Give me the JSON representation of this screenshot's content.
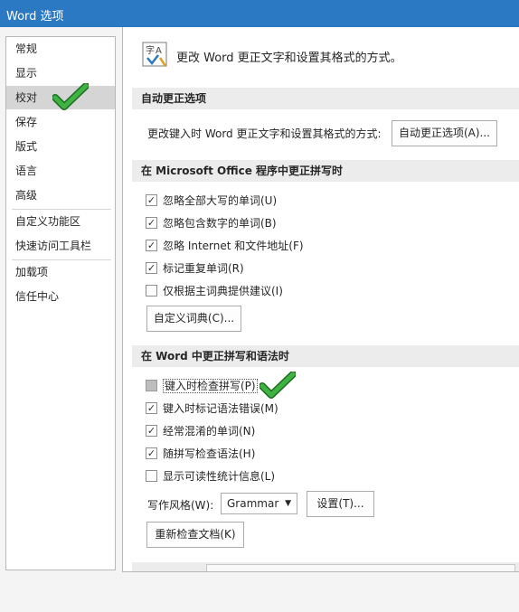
{
  "window": {
    "title": "Word 选项"
  },
  "sidebar": {
    "items": [
      {
        "label": "常规"
      },
      {
        "label": "显示"
      },
      {
        "label": "校对"
      },
      {
        "label": "保存"
      },
      {
        "label": "版式"
      },
      {
        "label": "语言"
      },
      {
        "label": "高级"
      },
      {
        "label": "自定义功能区"
      },
      {
        "label": "快速访问工具栏"
      },
      {
        "label": "加载项"
      },
      {
        "label": "信任中心"
      }
    ],
    "selected": "校对"
  },
  "header": {
    "text": "更改 Word 更正文字和设置其格式的方式。",
    "icon": "proofing-abc-check-icon"
  },
  "autocorrect": {
    "title": "自动更正选项",
    "description": "更改键入时 Word 更正文字和设置其格式的方式:",
    "button": "自动更正选项(A)..."
  },
  "office_spelling": {
    "title": "在 Microsoft Office 程序中更正拼写时",
    "options": [
      {
        "label": "忽略全部大写的单词(U)",
        "checked": true
      },
      {
        "label": "忽略包含数字的单词(B)",
        "checked": true
      },
      {
        "label": "忽略 Internet 和文件地址(F)",
        "checked": true
      },
      {
        "label": "标记重复单词(R)",
        "checked": true
      },
      {
        "label": "仅根据主词典提供建议(I)",
        "checked": false
      }
    ],
    "dictionary_button": "自定义词典(C)..."
  },
  "word_spelling": {
    "title": "在 Word 中更正拼写和语法时",
    "options": [
      {
        "label": "键入时检查拼写(P)",
        "checked": false
      },
      {
        "label": "键入时标记语法错误(M)",
        "checked": true
      },
      {
        "label": "经常混淆的单词(N)",
        "checked": true
      },
      {
        "label": "随拼写检查语法(H)",
        "checked": true
      },
      {
        "label": "显示可读性统计信息(L)",
        "checked": false
      }
    ],
    "writing_style_label": "写作风格(W):",
    "writing_style_value": "Grammar",
    "settings_button": "设置(T)...",
    "recheck_button": "重新检查文档(K)"
  },
  "colors": {
    "titlebar": "#2b79c2",
    "annotation_check": "#2fa335"
  }
}
